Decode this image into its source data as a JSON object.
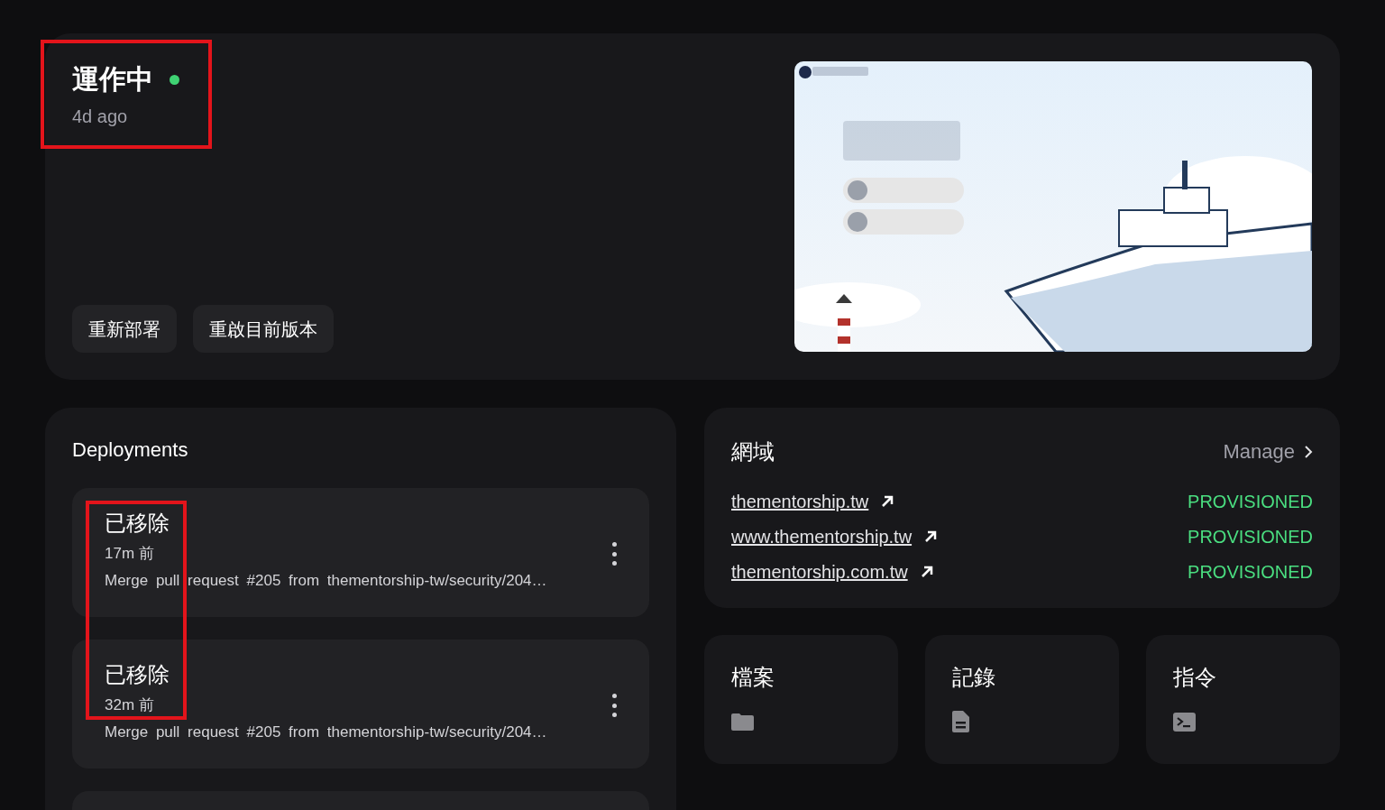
{
  "status": {
    "label": "運作中",
    "online": true,
    "time": "4d ago"
  },
  "actions": [
    "重新部署",
    "重啟目前版本"
  ],
  "preview": {
    "kind": "website-screenshot"
  },
  "deployments": {
    "title": "Deployments",
    "items": [
      {
        "status": "已移除",
        "time": "17m 前",
        "message": "Merge pull request #205 from thementorship-tw/security/204…"
      },
      {
        "status": "已移除",
        "time": "32m 前",
        "message": "Merge pull request #205 from thementorship-tw/security/204…"
      }
    ],
    "more_below": true
  },
  "domains": {
    "title": "網域",
    "manage": "Manage",
    "items": [
      {
        "host": "thementorship.tw",
        "state": "PROVISIONED"
      },
      {
        "host": "www.thementorship.tw",
        "state": "PROVISIONED"
      },
      {
        "host": "thementorship.com.tw",
        "state": "PROVISIONED"
      }
    ]
  },
  "tools": [
    {
      "label": "檔案",
      "kind": "folder"
    },
    {
      "label": "記錄",
      "kind": "log"
    },
    {
      "label": "指令",
      "kind": "terminal"
    }
  ],
  "highlights": [
    {
      "color": "#e3141b"
    },
    {
      "color": "#e3141b"
    }
  ]
}
